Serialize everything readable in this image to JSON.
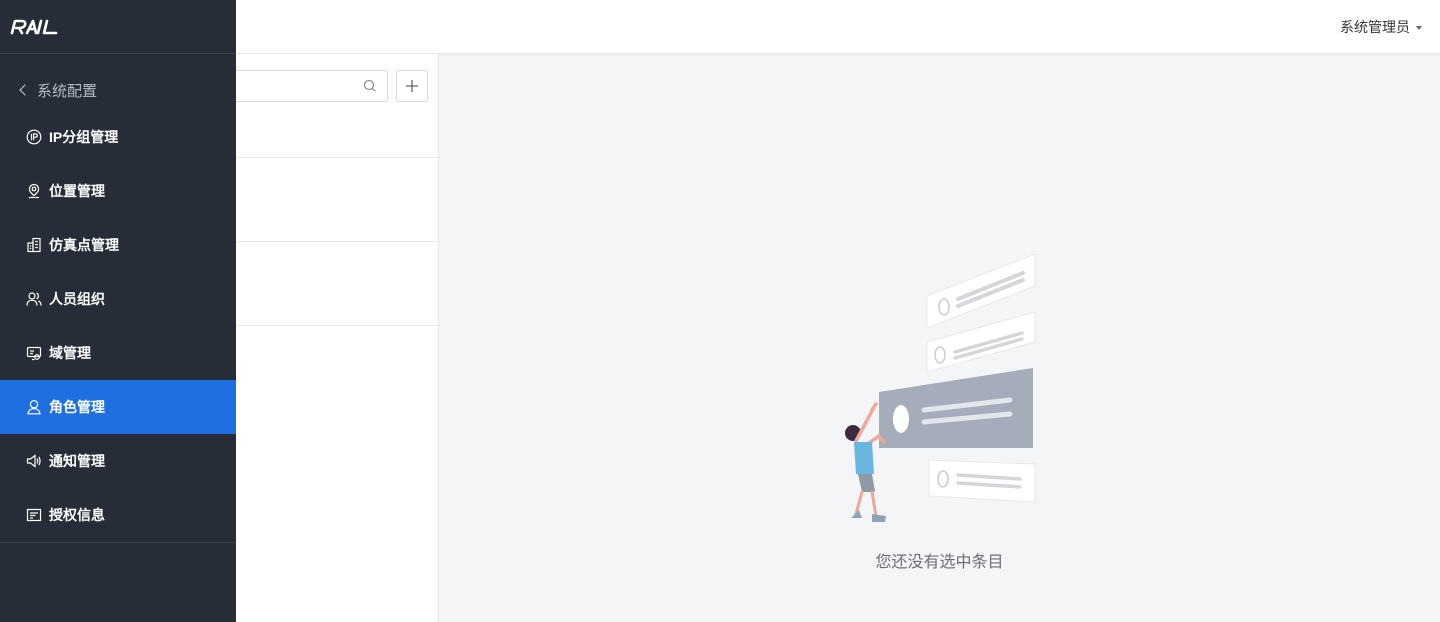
{
  "header": {
    "user_name": "系统管理员"
  },
  "sidebar": {
    "logo_text": "RAIL",
    "back_label": "系统配置",
    "items": [
      {
        "label": "IP分组管理",
        "icon": "ip-icon",
        "active": false
      },
      {
        "label": "位置管理",
        "icon": "location-icon",
        "active": false
      },
      {
        "label": "仿真点管理",
        "icon": "building-icon",
        "active": false
      },
      {
        "label": "人员组织",
        "icon": "people-icon",
        "active": false
      },
      {
        "label": "域管理",
        "icon": "domain-icon",
        "active": false
      },
      {
        "label": "角色管理",
        "icon": "user-icon",
        "active": true
      },
      {
        "label": "通知管理",
        "icon": "speaker-icon",
        "active": false
      },
      {
        "label": "授权信息",
        "icon": "license-icon",
        "active": false
      }
    ]
  },
  "list": {
    "search_placeholder": ""
  },
  "empty_state": {
    "message": "您还没有选中条目"
  },
  "colors": {
    "sidebar_bg": "#262d38",
    "active_item": "#1f6fe0",
    "content_bg": "#f4f5f7"
  }
}
